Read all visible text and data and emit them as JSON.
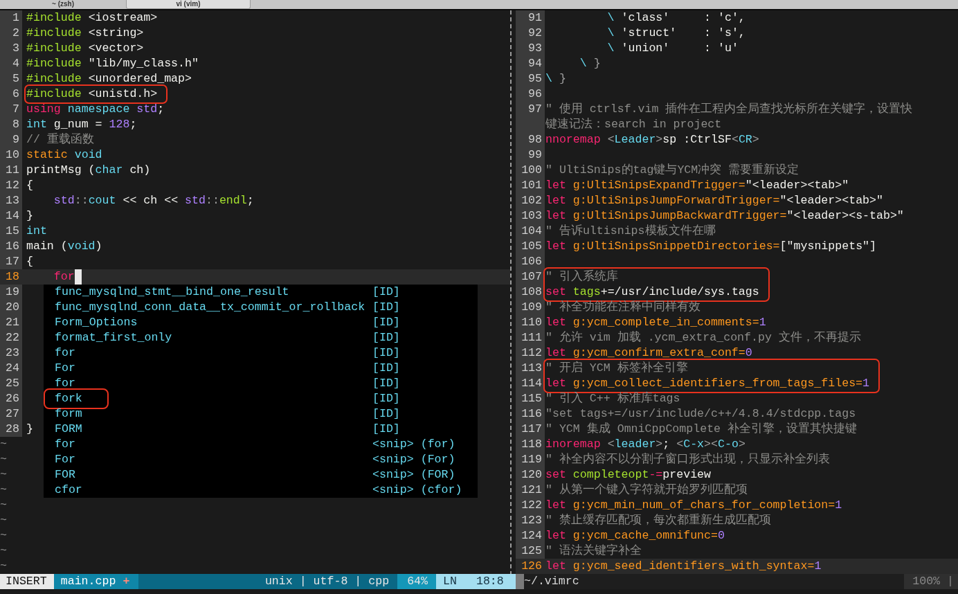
{
  "tabs": [
    {
      "label": "~ (zsh)",
      "selected": false
    },
    {
      "label": "vi (vim)",
      "selected": true
    }
  ],
  "left": {
    "entries": [
      {
        "kind": "line",
        "number": "1",
        "current": false,
        "segments": [
          {
            "kind": "preproc",
            "text": "#include"
          },
          {
            "kind": "plain",
            "text": " <iostream>"
          }
        ]
      },
      {
        "kind": "line",
        "number": "2",
        "current": false,
        "segments": [
          {
            "kind": "preproc",
            "text": "#include"
          },
          {
            "kind": "plain",
            "text": " <string>"
          }
        ]
      },
      {
        "kind": "line",
        "number": "3",
        "current": false,
        "segments": [
          {
            "kind": "preproc",
            "text": "#include"
          },
          {
            "kind": "plain",
            "text": " <vector>"
          }
        ]
      },
      {
        "kind": "line",
        "number": "4",
        "current": false,
        "segments": [
          {
            "kind": "preproc",
            "text": "#include"
          },
          {
            "kind": "plain",
            "text": " \"lib/my_class.h\""
          }
        ]
      },
      {
        "kind": "line",
        "number": "5",
        "current": false,
        "segments": [
          {
            "kind": "preproc",
            "text": "#include"
          },
          {
            "kind": "plain",
            "text": " <unordered_map>"
          }
        ]
      },
      {
        "kind": "box",
        "lines": [
          {
            "number": "6",
            "current": false,
            "segments": [
              {
                "kind": "preproc",
                "text": "#include"
              },
              {
                "kind": "plain",
                "text": " <unistd.h>"
              }
            ]
          }
        ]
      },
      {
        "kind": "line",
        "number": "7",
        "current": false,
        "segments": [
          {
            "kind": "keyword",
            "text": "using "
          },
          {
            "kind": "type",
            "text": "namespace "
          },
          {
            "kind": "number",
            "text": "std"
          },
          {
            "kind": "plain",
            "text": ";"
          }
        ]
      },
      {
        "kind": "line",
        "number": "8",
        "current": false,
        "segments": [
          {
            "kind": "type",
            "text": "int"
          },
          {
            "kind": "plain",
            "text": " g_num = "
          },
          {
            "kind": "number",
            "text": "128"
          },
          {
            "kind": "plain",
            "text": ";"
          }
        ]
      },
      {
        "kind": "line",
        "number": "9",
        "current": false,
        "segments": [
          {
            "kind": "comment",
            "text": "// 重载函数"
          }
        ]
      },
      {
        "kind": "line",
        "number": "10",
        "current": false,
        "segments": [
          {
            "kind": "storage",
            "text": "static "
          },
          {
            "kind": "type",
            "text": "void"
          }
        ]
      },
      {
        "kind": "line",
        "number": "11",
        "current": false,
        "segments": [
          {
            "kind": "plain",
            "text": "printMsg ("
          },
          {
            "kind": "type",
            "text": "char"
          },
          {
            "kind": "plain",
            "text": " ch)"
          }
        ]
      },
      {
        "kind": "line",
        "number": "12",
        "current": false,
        "segments": [
          {
            "kind": "plain",
            "text": "{"
          }
        ]
      },
      {
        "kind": "line",
        "number": "13",
        "current": false,
        "segments": [
          {
            "kind": "number",
            "text": "    std"
          },
          {
            "kind": "delim",
            "text": "::"
          },
          {
            "kind": "type",
            "text": "cout"
          },
          {
            "kind": "plain",
            "text": " << ch << "
          },
          {
            "kind": "number",
            "text": "std"
          },
          {
            "kind": "delim",
            "text": "::"
          },
          {
            "kind": "special",
            "text": "endl"
          },
          {
            "kind": "plain",
            "text": ";"
          }
        ]
      },
      {
        "kind": "line",
        "number": "14",
        "current": false,
        "segments": [
          {
            "kind": "plain",
            "text": "}"
          }
        ]
      },
      {
        "kind": "line",
        "number": "15",
        "current": false,
        "segments": [
          {
            "kind": "type",
            "text": "int"
          }
        ]
      },
      {
        "kind": "line",
        "number": "16",
        "current": false,
        "segments": [
          {
            "kind": "plain",
            "text": "main ("
          },
          {
            "kind": "type",
            "text": "void"
          },
          {
            "kind": "plain",
            "text": ")"
          }
        ]
      },
      {
        "kind": "line",
        "number": "17",
        "current": false,
        "segments": [
          {
            "kind": "plain",
            "text": "{"
          }
        ]
      },
      {
        "kind": "line",
        "number": "18",
        "current": true,
        "cursor": true,
        "segments": [
          {
            "kind": "keyword",
            "text": "    for"
          }
        ]
      },
      {
        "kind": "line",
        "number": "19",
        "current": false
      },
      {
        "kind": "line",
        "number": "20",
        "current": false
      },
      {
        "kind": "line",
        "number": "21",
        "current": false
      },
      {
        "kind": "line",
        "number": "22",
        "current": false
      },
      {
        "kind": "line",
        "number": "23",
        "current": false
      },
      {
        "kind": "line",
        "number": "24",
        "current": false
      },
      {
        "kind": "line",
        "number": "25",
        "current": false
      },
      {
        "kind": "line",
        "number": "26",
        "current": false
      },
      {
        "kind": "line",
        "number": "27",
        "current": false
      },
      {
        "kind": "line",
        "number": "28",
        "current": false,
        "segments": [
          {
            "kind": "plain",
            "text": "}"
          }
        ]
      }
    ],
    "filler": [
      "~",
      "~",
      "~",
      "~",
      "~",
      "~",
      "~",
      "~",
      "~"
    ],
    "completion": [
      {
        "word": "func_mysqlnd_stmt__bind_one_result",
        "menu": "[ID]",
        "boxed": false
      },
      {
        "word": "func_mysqlnd_conn_data__tx_commit_or_rollback",
        "menu": "[ID]",
        "boxed": false
      },
      {
        "word": "Form_Options",
        "menu": "[ID]",
        "boxed": false
      },
      {
        "word": "format_first_only",
        "menu": "[ID]",
        "boxed": false
      },
      {
        "word": "for",
        "menu": "[ID]",
        "boxed": false
      },
      {
        "word": "For",
        "menu": "[ID]",
        "boxed": false
      },
      {
        "word": "for",
        "menu": "[ID]",
        "boxed": false
      },
      {
        "word": "fork",
        "menu": "[ID]",
        "boxed": true
      },
      {
        "word": "form",
        "menu": "[ID]",
        "boxed": false
      },
      {
        "word": "FORM",
        "menu": "[ID]",
        "boxed": false
      },
      {
        "word": "for",
        "menu": "<snip> (for)",
        "boxed": false
      },
      {
        "word": "For",
        "menu": "<snip> (For)",
        "boxed": false
      },
      {
        "word": "FOR",
        "menu": "<snip> (FOR)",
        "boxed": false
      },
      {
        "word": "cfor",
        "menu": "<snip> (cfor)",
        "boxed": false
      }
    ],
    "status": {
      "mode": "INSERT",
      "file": "main.cpp",
      "modified": "+",
      "format": "unix | utf-8 | cpp",
      "percent": "64%",
      "ln_label": "LN",
      "position": "18:8"
    }
  },
  "right": {
    "entries": [
      {
        "kind": "line",
        "number": "91",
        "current": false,
        "segments": [
          {
            "kind": "type",
            "text": "         \\"
          },
          {
            "kind": "plain",
            "text": " 'class'     : 'c',"
          }
        ]
      },
      {
        "kind": "line",
        "number": "92",
        "current": false,
        "segments": [
          {
            "kind": "type",
            "text": "         \\"
          },
          {
            "kind": "plain",
            "text": " 'struct'    : 's',"
          }
        ]
      },
      {
        "kind": "line",
        "number": "93",
        "current": false,
        "segments": [
          {
            "kind": "type",
            "text": "         \\"
          },
          {
            "kind": "plain",
            "text": " 'union'     : 'u'"
          }
        ]
      },
      {
        "kind": "line",
        "number": "94",
        "current": false,
        "segments": [
          {
            "kind": "type",
            "text": "     \\"
          },
          {
            "kind": "delim",
            "text": " }"
          }
        ]
      },
      {
        "kind": "line",
        "number": "95",
        "current": false,
        "segments": [
          {
            "kind": "type",
            "text": "\\"
          },
          {
            "kind": "delim",
            "text": " }"
          }
        ]
      },
      {
        "kind": "line",
        "number": "96",
        "current": false
      },
      {
        "kind": "line",
        "number": "97",
        "current": false,
        "segments": [
          {
            "kind": "comment",
            "text": "\" 使用 ctrlsf.vim 插件在工程内全局查找光标所在关键字，设置快"
          }
        ],
        "continuation": [
          {
            "kind": "comment",
            "text": "键速记法：search in project"
          }
        ]
      },
      {
        "kind": "line",
        "number": "98",
        "current": false,
        "segments": [
          {
            "kind": "keyword",
            "text": "nnoremap"
          },
          {
            "kind": "delim",
            "text": " <"
          },
          {
            "kind": "type",
            "text": "Leader"
          },
          {
            "kind": "delim",
            "text": ">"
          },
          {
            "kind": "plain",
            "text": "sp :CtrlSF"
          },
          {
            "kind": "delim",
            "text": "<"
          },
          {
            "kind": "type",
            "text": "CR"
          },
          {
            "kind": "delim",
            "text": ">"
          }
        ]
      },
      {
        "kind": "line",
        "number": "99",
        "current": false
      },
      {
        "kind": "line",
        "number": "100",
        "current": false,
        "segments": [
          {
            "kind": "comment",
            "text": "\" UltiSnips的tag键与YCM冲突 需要重新设定"
          }
        ]
      },
      {
        "kind": "line",
        "number": "101",
        "current": false,
        "segments": [
          {
            "kind": "keyword",
            "text": "let "
          },
          {
            "kind": "storage",
            "text": "g:UltiSnipsExpandTrigger="
          },
          {
            "kind": "plain",
            "text": "\"<leader><tab>\""
          }
        ]
      },
      {
        "kind": "line",
        "number": "102",
        "current": false,
        "segments": [
          {
            "kind": "keyword",
            "text": "let "
          },
          {
            "kind": "storage",
            "text": "g:UltiSnipsJumpForwardTrigger="
          },
          {
            "kind": "plain",
            "text": "\"<leader><tab>\""
          }
        ]
      },
      {
        "kind": "line",
        "number": "103",
        "current": false,
        "segments": [
          {
            "kind": "keyword",
            "text": "let "
          },
          {
            "kind": "storage",
            "text": "g:UltiSnipsJumpBackwardTrigger="
          },
          {
            "kind": "plain",
            "text": "\"<leader><s-tab>\""
          }
        ]
      },
      {
        "kind": "line",
        "number": "104",
        "current": false,
        "segments": [
          {
            "kind": "comment",
            "text": "\" 告诉ultisnips模板文件在哪"
          }
        ]
      },
      {
        "kind": "line",
        "number": "105",
        "current": false,
        "segments": [
          {
            "kind": "keyword",
            "text": "let "
          },
          {
            "kind": "storage",
            "text": "g:UltiSnipsSnippetDirectories="
          },
          {
            "kind": "plain",
            "text": "[\"mysnippets\"]"
          }
        ]
      },
      {
        "kind": "line",
        "number": "106",
        "current": false
      },
      {
        "kind": "box",
        "lines": [
          {
            "number": "107",
            "current": false,
            "segments": [
              {
                "kind": "comment",
                "text": "\" 引入系统库"
              }
            ]
          },
          {
            "number": "108",
            "current": false,
            "segments": [
              {
                "kind": "keyword",
                "text": "set "
              },
              {
                "kind": "special",
                "text": "tags"
              },
              {
                "kind": "plain",
                "text": "+=/usr/include/sys.tags"
              }
            ]
          }
        ]
      },
      {
        "kind": "line",
        "number": "109",
        "current": false,
        "segments": [
          {
            "kind": "comment",
            "text": "\" 补全功能在注释中同样有效"
          }
        ]
      },
      {
        "kind": "line",
        "number": "110",
        "current": false,
        "segments": [
          {
            "kind": "keyword",
            "text": "let "
          },
          {
            "kind": "storage",
            "text": "g:ycm_complete_in_comments="
          },
          {
            "kind": "number",
            "text": "1"
          }
        ]
      },
      {
        "kind": "line",
        "number": "111",
        "current": false,
        "segments": [
          {
            "kind": "comment",
            "text": "\" 允许 vim 加载 .ycm_extra_conf.py 文件，不再提示"
          }
        ]
      },
      {
        "kind": "line",
        "number": "112",
        "current": false,
        "segments": [
          {
            "kind": "keyword",
            "text": "let "
          },
          {
            "kind": "storage",
            "text": "g:ycm_confirm_extra_conf="
          },
          {
            "kind": "number",
            "text": "0"
          }
        ]
      },
      {
        "kind": "box",
        "lines": [
          {
            "number": "113",
            "current": false,
            "segments": [
              {
                "kind": "comment",
                "text": "\" 开启 YCM 标签补全引擎"
              }
            ]
          },
          {
            "number": "114",
            "current": false,
            "segments": [
              {
                "kind": "keyword",
                "text": "let "
              },
              {
                "kind": "storage",
                "text": "g:ycm_collect_identifiers_from_tags_files="
              },
              {
                "kind": "number",
                "text": "1"
              }
            ]
          }
        ]
      },
      {
        "kind": "line",
        "number": "115",
        "current": false,
        "segments": [
          {
            "kind": "comment",
            "text": "\" 引入 C++ 标准库tags"
          }
        ]
      },
      {
        "kind": "line",
        "number": "116",
        "current": false,
        "segments": [
          {
            "kind": "comment",
            "text": "\"set tags+=/usr/include/c++/4.8.4/stdcpp.tags"
          }
        ]
      },
      {
        "kind": "line",
        "number": "117",
        "current": false,
        "segments": [
          {
            "kind": "comment",
            "text": "\" YCM 集成 OmniCppComplete 补全引擎，设置其快捷键"
          }
        ]
      },
      {
        "kind": "line",
        "number": "118",
        "current": false,
        "segments": [
          {
            "kind": "keyword",
            "text": "inoremap"
          },
          {
            "kind": "delim",
            "text": " <"
          },
          {
            "kind": "type",
            "text": "leader"
          },
          {
            "kind": "delim",
            "text": ">"
          },
          {
            "kind": "plain",
            "text": "; "
          },
          {
            "kind": "delim",
            "text": "<"
          },
          {
            "kind": "type",
            "text": "C-x"
          },
          {
            "kind": "delim",
            "text": "><"
          },
          {
            "kind": "type",
            "text": "C-o"
          },
          {
            "kind": "delim",
            "text": ">"
          }
        ]
      },
      {
        "kind": "line",
        "number": "119",
        "current": false,
        "segments": [
          {
            "kind": "comment",
            "text": "\" 补全内容不以分割子窗口形式出现，只显示补全列表"
          }
        ]
      },
      {
        "kind": "line",
        "number": "120",
        "current": false,
        "segments": [
          {
            "kind": "keyword",
            "text": "set "
          },
          {
            "kind": "special",
            "text": "completeopt"
          },
          {
            "kind": "keyword",
            "text": "-="
          },
          {
            "kind": "plain",
            "text": "preview"
          }
        ]
      },
      {
        "kind": "line",
        "number": "121",
        "current": false,
        "segments": [
          {
            "kind": "comment",
            "text": "\" 从第一个键入字符就开始罗列匹配项"
          }
        ]
      },
      {
        "kind": "line",
        "number": "122",
        "current": false,
        "segments": [
          {
            "kind": "keyword",
            "text": "let "
          },
          {
            "kind": "storage",
            "text": "g:ycm_min_num_of_chars_for_completion="
          },
          {
            "kind": "number",
            "text": "1"
          }
        ]
      },
      {
        "kind": "line",
        "number": "123",
        "current": false,
        "segments": [
          {
            "kind": "comment",
            "text": "\" 禁止缓存匹配项，每次都重新生成匹配项"
          }
        ]
      },
      {
        "kind": "line",
        "number": "124",
        "current": false,
        "segments": [
          {
            "kind": "keyword",
            "text": "let "
          },
          {
            "kind": "storage",
            "text": "g:ycm_cache_omnifunc="
          },
          {
            "kind": "number",
            "text": "0"
          }
        ]
      },
      {
        "kind": "line",
        "number": "125",
        "current": false,
        "segments": [
          {
            "kind": "comment",
            "text": "\" 语法关键字补全"
          }
        ]
      },
      {
        "kind": "line",
        "number": "126",
        "current": true,
        "segments": [
          {
            "kind": "keyword",
            "text": "let "
          },
          {
            "kind": "storage",
            "text": "g:ycm_seed_identifiers_with_syntax="
          },
          {
            "kind": "number",
            "text": "1"
          }
        ]
      }
    ],
    "status": {
      "file": "~/.vimrc",
      "percent": "100% |"
    }
  }
}
